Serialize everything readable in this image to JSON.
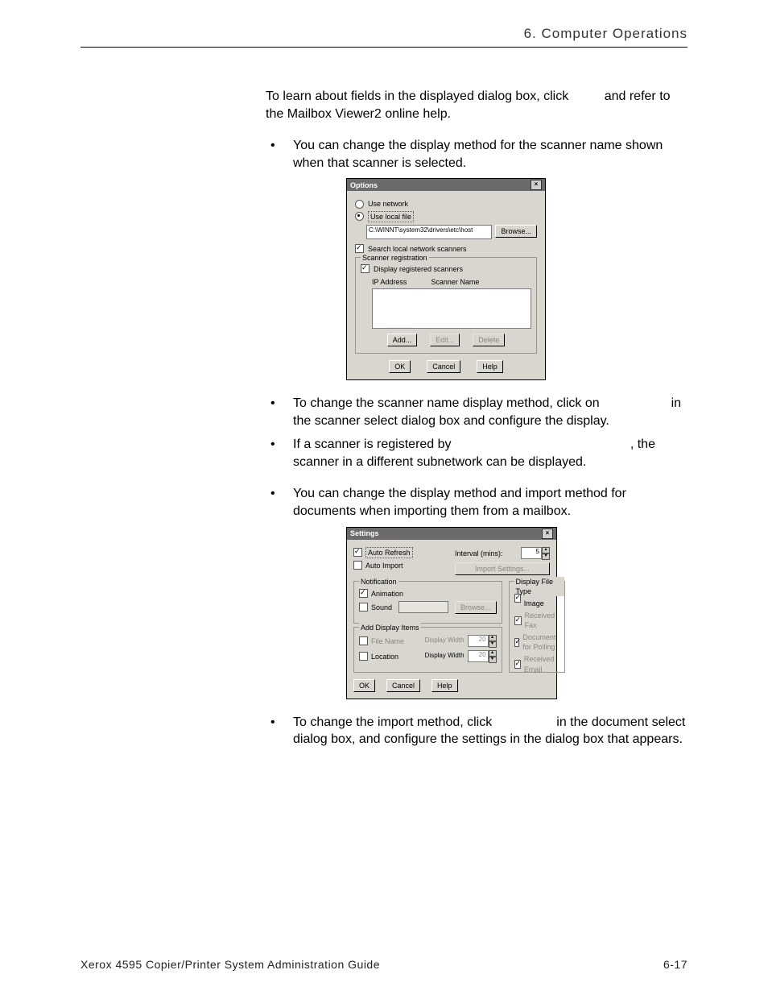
{
  "header": {
    "title": "6. Computer Operations"
  },
  "intro": {
    "line1": "To learn about fields in the displayed dialog box, click",
    "line2": "and refer to the Mailbox Viewer2 online help."
  },
  "bullet1": "You can change the display method for the scanner name shown when that scanner is selected.",
  "options_dialog": {
    "title": "Options",
    "use_network": "Use network",
    "use_local_file": "Use local file",
    "path": "C:\\WINNT\\system32\\drivers\\etc\\host",
    "browse": "Browse...",
    "search_local": "Search local network scanners",
    "scanner_registration": "Scanner registration",
    "display_registered": "Display registered scanners",
    "col_ip": "IP Address",
    "col_name": "Scanner Name",
    "add": "Add...",
    "edit": "Edit...",
    "delete": "Delete",
    "ok": "OK",
    "cancel": "Cancel",
    "help": "Help"
  },
  "bullet2": {
    "a": "To change the scanner name display method, click on",
    "b": "in the scanner select dialog box and configure the display."
  },
  "bullet3": {
    "a": "If a scanner is registered by",
    "b": ", the scanner in a different subnetwork can be displayed."
  },
  "bullet4": "You can change the display method and import method for documents when importing them from a mailbox.",
  "settings_dialog": {
    "title": "Settings",
    "auto_refresh": "Auto Refresh",
    "auto_import": "Auto Import",
    "interval_label": "Interval (mins):",
    "interval_value": "5",
    "import_settings": "Import Settings...",
    "notification": "Notification",
    "animation": "Animation",
    "sound": "Sound",
    "browse": "Browse...",
    "add_display_items": "Add Display Items",
    "file_name": "File Name",
    "location": "Location",
    "display_width": "Display Width",
    "dw1": "20",
    "dw2": "20",
    "display_file_type": "Display File Type",
    "scanned_image": "Scanned Image",
    "received_fax": "Received Fax",
    "document_for_polling": "Document for Polling",
    "received_email": "Received Email",
    "ok": "OK",
    "cancel": "Cancel",
    "help": "Help"
  },
  "bullet5": {
    "a": "To change the import method, click",
    "b": "in the document select dialog box, and configure the settings in the dialog box that appears."
  },
  "footer": {
    "left": "Xerox 4595 Copier/Printer System Administration Guide",
    "right": "6-17"
  }
}
